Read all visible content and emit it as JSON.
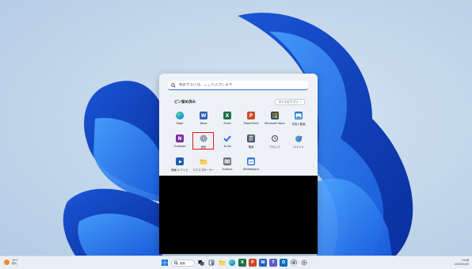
{
  "start_menu": {
    "search_placeholder": "検索するには、ここに入力します",
    "pinned_header": "ピン留め済み",
    "all_apps_label": "すべてのアプリ",
    "apps": [
      {
        "label": "Edge",
        "icon": "edge-icon",
        "color": "#1c8de0"
      },
      {
        "label": "Word",
        "icon": "word-icon",
        "color": "#2b5fb8"
      },
      {
        "label": "Excel",
        "icon": "excel-icon",
        "color": "#1e7145"
      },
      {
        "label": "PowerPoint",
        "icon": "powerpoint-icon",
        "color": "#d24726"
      },
      {
        "label": "Microsoft Store",
        "icon": "store-icon",
        "color": "#3b4a5c"
      },
      {
        "label": "写真と動画",
        "icon": "photos-icon",
        "color": "#2a7fd4"
      },
      {
        "label": "OneNote",
        "icon": "onenote-icon",
        "color": "#7b2fa4"
      },
      {
        "label": "設定",
        "icon": "settings-gear-icon",
        "color": "#5a6370",
        "highlighted": true
      },
      {
        "label": "To Do",
        "icon": "todo-icon",
        "color": "#2f6fe0"
      },
      {
        "label": "電卓",
        "icon": "calculator-icon",
        "color": "#4b5563"
      },
      {
        "label": "クロック",
        "icon": "clock-icon",
        "color": "#374151"
      },
      {
        "label": "ペイント",
        "icon": "paint-icon",
        "color": "#2aa0d8"
      },
      {
        "label": "映画 & テレビ",
        "icon": "movies-icon",
        "color": "#1f5fae"
      },
      {
        "label": "エクスプローラー",
        "icon": "folder-icon",
        "color": "#f2b431"
      },
      {
        "label": "Surface",
        "icon": "surface-icon",
        "color": "#6b7280"
      },
      {
        "label": "Whiteboard",
        "icon": "whiteboard-icon",
        "color": "#2f7ad6"
      }
    ]
  },
  "taskbar": {
    "weather_temp": "19°C",
    "weather_desc": "晴れ",
    "search_label": "検索",
    "time": "14:48",
    "date": "2023/01/05"
  }
}
